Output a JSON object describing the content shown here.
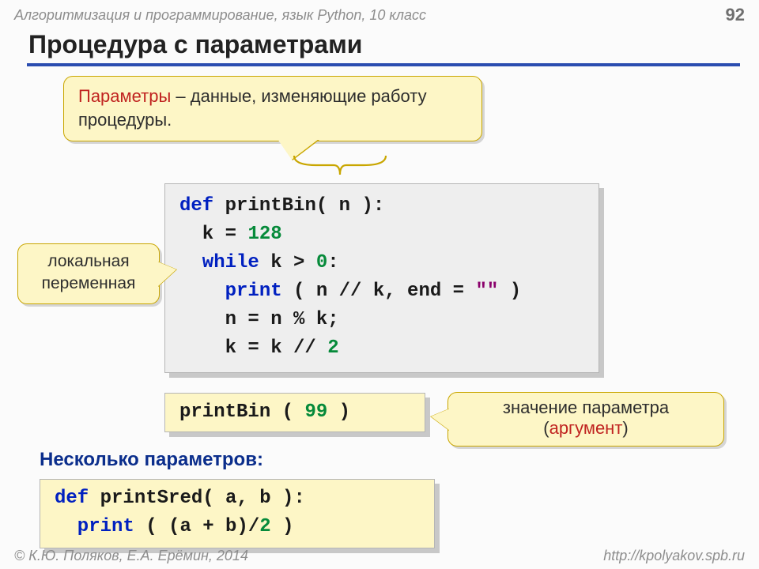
{
  "header": {
    "course": "Алгоритмизация и программирование, язык Python, 10 класс",
    "page": "92"
  },
  "title": "Процедура с параметрами",
  "callouts": {
    "params": {
      "term": "Параметры",
      "rest": " – данные, изменяющие работу процедуры."
    },
    "localvar": {
      "line1": "локальная",
      "line2": "переменная"
    },
    "arg": {
      "line1": "значение параметра",
      "open": "(",
      "term": "аргумент",
      "close": ")"
    }
  },
  "code_def": {
    "l1_def": "def",
    "l1_rest": " printBin( n ):",
    "l2_a": "  k",
    "l2_eq": " = ",
    "l2_num": "128",
    "l3_while": "  while",
    "l3_mid": " k",
    "l3_gt": " > ",
    "l3_num": "0",
    "l3_colon": ":",
    "l4_print": "    print",
    "l4_open": " ( n",
    "l4_div": " // ",
    "l4_k": "k, end",
    "l4_eq": " = ",
    "l4_str": "\"\"",
    "l4_close": " )",
    "l5": "    n = n % k;",
    "l6_a": "    k = k",
    "l6_div": " // ",
    "l6_num": "2"
  },
  "code_call": {
    "name": "printBin ( ",
    "arg": "99",
    "close": " )"
  },
  "subtitle": "Несколько параметров:",
  "code_sred": {
    "l1_def": "def",
    "l1_rest": " printSred( a, b ):",
    "l2_print": "  print",
    "l2_rest": " ( (a + b)/",
    "l2_num": "2",
    "l2_close": " )"
  },
  "footer": {
    "left": "© К.Ю. Поляков, Е.А. Ерёмин, 2014",
    "right": "http://kpolyakov.spb.ru"
  }
}
